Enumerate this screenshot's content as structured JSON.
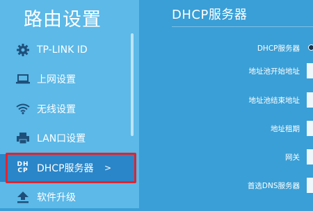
{
  "sidebar": {
    "title": "路由设置",
    "items": [
      {
        "label": "TP-LINK ID",
        "icon": "gear-icon"
      },
      {
        "label": "上网设置",
        "icon": "laptop-icon"
      },
      {
        "label": "无线设置",
        "icon": "wifi-icon"
      },
      {
        "label": "LAN口设置",
        "icon": "printer-icon"
      },
      {
        "label": "DHCP服务器",
        "icon": "dhcp-icon",
        "icon_text_top": "DH",
        "icon_text_bottom": "CP",
        "arrow": ">",
        "active": true
      },
      {
        "label": "软件升级",
        "icon": "upload-icon"
      }
    ]
  },
  "main": {
    "title": "DHCP服务器",
    "fields": [
      {
        "label": "DHCP服务器"
      },
      {
        "label": "地址池开始地址"
      },
      {
        "label": "地址池结束地址"
      },
      {
        "label": "地址租期"
      },
      {
        "label": "网关"
      },
      {
        "label": "首选DNS服务器"
      }
    ]
  },
  "colors": {
    "background": "#3a9fd6",
    "sidebar": "#5cb9e8",
    "active_item": "#2a86c8",
    "highlight_border": "#e0242e"
  }
}
